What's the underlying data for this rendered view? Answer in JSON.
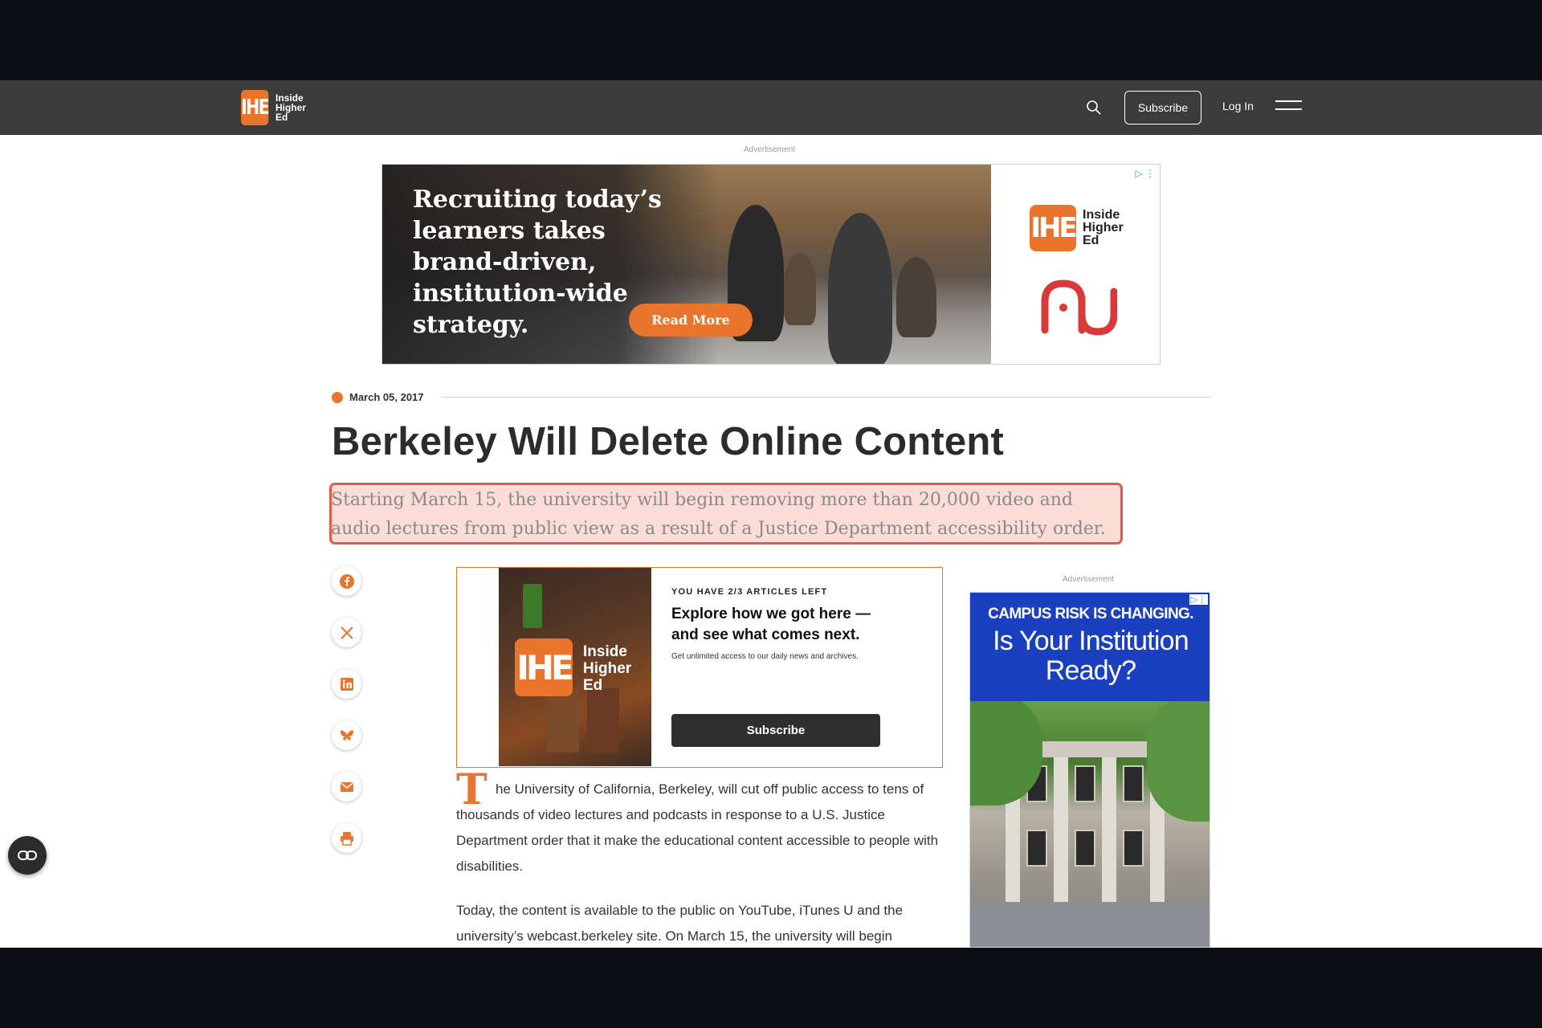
{
  "header": {
    "logo_line1": "Inside",
    "logo_line2": "Higher",
    "logo_line3": "Ed",
    "logo_mark": "IHE",
    "subscribe_label": "Subscribe",
    "login_label": "Log In",
    "icons": [
      "search-icon",
      "menu-icon"
    ]
  },
  "top_ad": {
    "label": "Advertisement",
    "headline": "Recruiting today’s learners takes brand-driven, institution-wide strategy.",
    "cta": "Read More",
    "badge_mark": "IHE",
    "badge_line1": "Inside",
    "badge_line2": "Higher",
    "badge_line3": "Ed",
    "ad_choice": "▷ ⋮"
  },
  "article": {
    "date": "March 05, 2017",
    "title": "Berkeley Will Delete Online Content",
    "dek": "Starting March 15, the university will begin removing more than 20,000 video and audio lectures from public view as a result of a Justice Department accessibility order.",
    "dropcap": "T",
    "paragraph1": "he University of California, Berkeley, will cut off public access to tens of thousands of video lectures and podcasts in response to a U.S. Justice Department order that it make the educational content accessible to people with disabilities.",
    "paragraph2": "Today, the content is available to the public on YouTube, iTunes U and the university’s webcast.berkeley site. On March 15, the university will begin"
  },
  "share": [
    "facebook-icon",
    "x-icon",
    "linkedin-icon",
    "bluesky-icon",
    "email-icon",
    "print-icon"
  ],
  "paywall": {
    "kicker": "YOU HAVE 2/3 ARTICLES LEFT",
    "headline": "Explore how we got here — and see what comes next.",
    "sub": "Get unlimited access to our daily news and archives.",
    "cta": "Subscribe",
    "img_mark": "IHE",
    "img_line1": "Inside",
    "img_line2": "Higher",
    "img_line3": "Ed"
  },
  "side_ad": {
    "label": "Advertisement",
    "kicker": "CAMPUS RISK IS CHANGING.",
    "headline": "Is Your Institution Ready?",
    "ad_choice": "▷⋮"
  },
  "colors": {
    "accent": "#e8752b",
    "header": "#3b3b3b",
    "highlight": "#fbdcd7",
    "highlight_border": "#e25a4a",
    "side_ad_blue": "#1a3fbf"
  }
}
